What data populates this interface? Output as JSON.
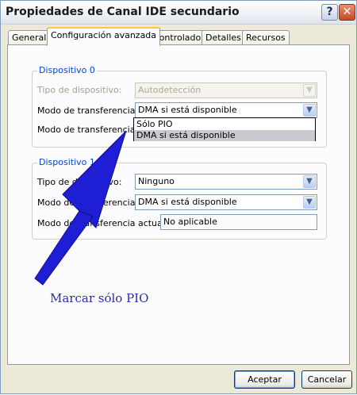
{
  "window": {
    "title": "Propiedades de Canal IDE secundario",
    "help_label": "?",
    "close_label": "✕"
  },
  "tabs": [
    {
      "label": "General"
    },
    {
      "label": "Configuración avanzada",
      "active": true
    },
    {
      "label": "Controlador"
    },
    {
      "label": "Detalles"
    },
    {
      "label": "Recursos"
    }
  ],
  "device0": {
    "legend": "Dispositivo 0",
    "device_type_label": "Tipo de dispositivo:",
    "device_type_value": "Autodetección",
    "transfer_mode_label": "Modo de transferencia:",
    "transfer_mode_value": "DMA si está disponible",
    "current_mode_label": "Modo de transferencia actual:",
    "dropdown_options": [
      "Sólo PIO",
      "DMA si está disponible"
    ],
    "dropdown_selected": "DMA si está disponible"
  },
  "device1": {
    "legend": "Dispositivo 1",
    "device_type_label": "Tipo de dispositivo:",
    "device_type_value": "Ninguno",
    "transfer_mode_label": "Modo de transferencia:",
    "transfer_mode_value": "DMA si está disponible",
    "current_mode_label": "Modo de transferencia actual:",
    "current_mode_value": "No aplicable"
  },
  "annotation": {
    "text": "Marcar sólo PIO",
    "color": "#2c2ca8"
  },
  "buttons": {
    "accept": "Aceptar",
    "cancel": "Cancelar"
  },
  "icons": {
    "dropdown_arrow": "chevron-down-icon",
    "close": "close-icon",
    "help": "help-icon",
    "pointer": "arrow-pointer-icon"
  }
}
